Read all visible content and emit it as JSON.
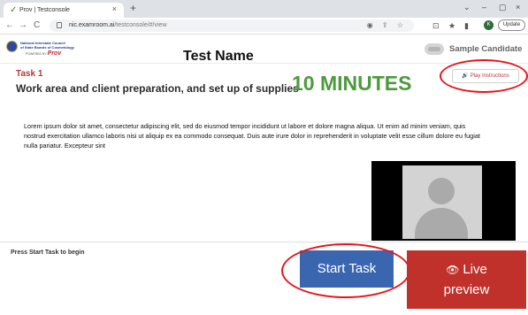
{
  "browser": {
    "tab_title": "Prov | Testconsole",
    "tab_favicon": "check-icon",
    "tab_close": "×",
    "new_tab": "+",
    "url_host": "nic.examroom.ai",
    "url_path": "/testconsole/#/view",
    "back": "←",
    "forward": "→",
    "reload": "C",
    "omnibox_icons": "◉ ⇪ ☆",
    "ext_icons": [
      "⊡",
      "★",
      "▮"
    ],
    "profile_initial": "K",
    "update_label": "Update",
    "menu": "⋮",
    "window_controls": [
      "⌄",
      "–",
      "▢",
      "×"
    ]
  },
  "header": {
    "logo_line1": "National Interstate Council",
    "logo_line2": "of State Boards of Cosmetology",
    "logo_powered": "POWERED BY",
    "logo_brand": "Prov",
    "test_name": "Test Name",
    "candidate_name": "Sample Candidate"
  },
  "task": {
    "label": "Task 1",
    "title": "Work area and client preparation, and set up of supplies",
    "timer": "10 MINUTES",
    "play_instructions": "Play Instructions",
    "play_icon": "🔊",
    "body": "Lorem ipsum dolor sit amet, consectetur adipiscing elit, sed do eiusmod tempor incididunt ut labore et dolore magna aliqua. Ut enim ad minim veniam, quis nostrud exercitation ullamco laboris nisi ut aliquip ex ea commodo consequat. Duis aute irure dolor in reprehenderit in voluptate velit esse cillum dolore eu fugiat nulla pariatur. Excepteur sint"
  },
  "footer": {
    "press_start": "Press Start Task to begin",
    "start_task": "Start Task",
    "live_preview_line1": "Live",
    "live_preview_line2": "preview",
    "live_icon": "eye-slash-icon"
  },
  "colors": {
    "timer": "#4d9a3d",
    "task_label": "#b33a3a",
    "start_button": "#3a66b0",
    "live_button": "#c0312b",
    "annotation": "#e8141a"
  }
}
